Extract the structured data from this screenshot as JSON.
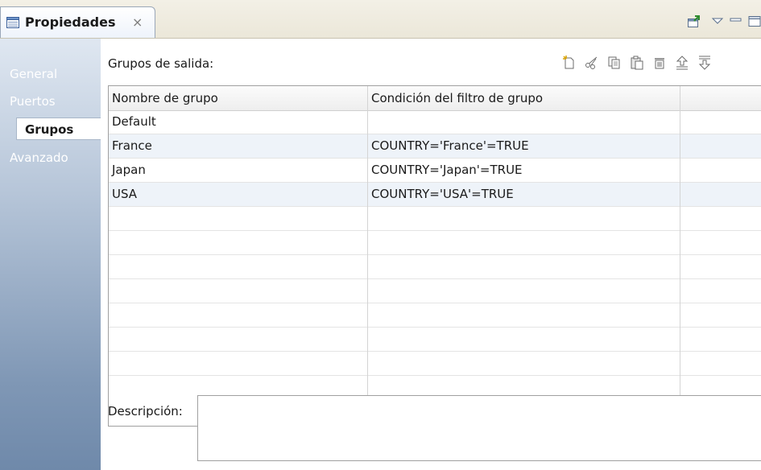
{
  "tab": {
    "title": "Propiedades",
    "close_glyph": "×"
  },
  "top_icons": [
    "new-window-icon",
    "view-menu-icon",
    "minimize-icon",
    "maximize-icon"
  ],
  "sidebar": {
    "items": [
      {
        "label": "General",
        "active": false
      },
      {
        "label": "Puertos",
        "active": false
      },
      {
        "label": "Grupos",
        "active": true
      },
      {
        "label": "Avanzado",
        "active": false
      }
    ]
  },
  "main": {
    "section_label": "Grupos de salida:",
    "toolbar_icons": [
      "new-icon",
      "cut-icon",
      "copy-icon",
      "paste-icon",
      "delete-icon",
      "move-up-icon",
      "move-down-icon"
    ],
    "table": {
      "columns": [
        "Nombre de grupo",
        "Condición del filtro de grupo",
        ""
      ],
      "rows": [
        [
          "Default",
          "",
          ""
        ],
        [
          "France",
          "COUNTRY='France'=TRUE",
          ""
        ],
        [
          "Japan",
          "COUNTRY='Japan'=TRUE",
          ""
        ],
        [
          "USA",
          "COUNTRY='USA'=TRUE",
          ""
        ]
      ],
      "empty_rows": 7
    },
    "description_label": "Descripción:",
    "description_value": ""
  },
  "colors": {
    "sidebar_top": "#dfe7f1",
    "sidebar_bottom": "#6f89aa",
    "alt_row": "#eef3f9",
    "toolbar_bg": "#ebe7d9"
  }
}
